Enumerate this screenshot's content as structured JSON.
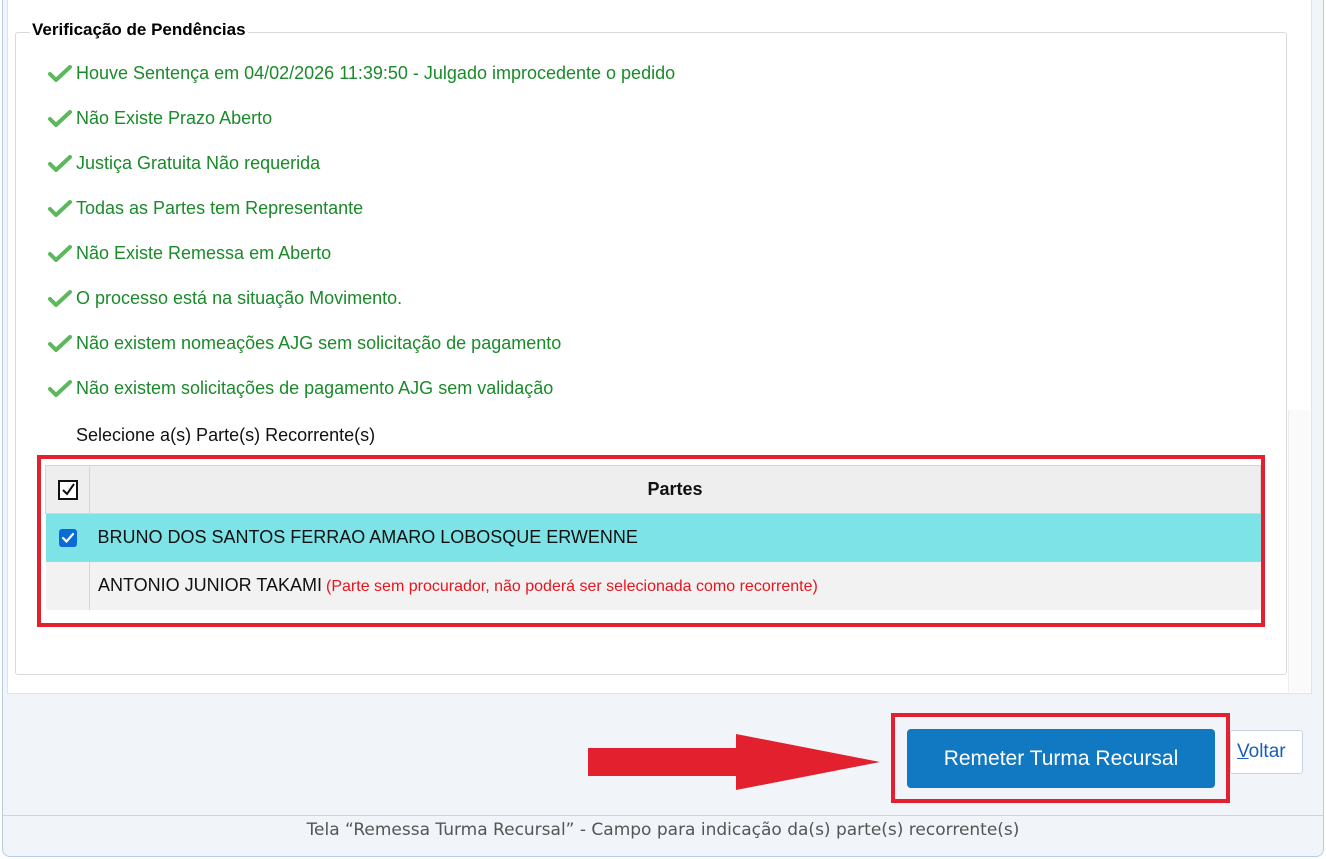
{
  "section": {
    "legend": "Verificação de Pendências",
    "checks": [
      "Houve Sentença em 04/02/2026 11:39:50 - Julgado improcedente o pedido",
      "Não Existe Prazo Aberto",
      "Justiça Gratuita Não requerida",
      "Todas as Partes tem Representante",
      "Não Existe Remessa em Aberto",
      "O processo está na situação Movimento.",
      "Não existem nomeações AJG sem solicitação de pagamento",
      "Não existem solicitações de pagamento AJG sem validação"
    ],
    "check_icon": "check-icon",
    "check_color": "#1a8a2a"
  },
  "selection": {
    "label": "Selecione a(s) Parte(s) Recorrente(s)",
    "header": "Partes",
    "header_checked": true,
    "rows": [
      {
        "name": "BRUNO DOS SANTOS FERRAO AMARO LOBOSQUE ERWENNE",
        "checked": true,
        "note": ""
      },
      {
        "name": "ANTONIO JUNIOR TAKAMI",
        "checked": false,
        "note": "(Parte sem procurador, não poderá ser selecionada como recorrente)"
      }
    ],
    "selected_row_color": "#7de3e6",
    "warning_color": "#e8141e"
  },
  "actions": {
    "primary_label": "Remeter Turma Recursal",
    "back_label_first": "V",
    "back_label_rest": "oltar",
    "primary_color": "#1178c2"
  },
  "annotation": {
    "highlight_color": "#e3202d",
    "arrow_color": "#e3202d"
  },
  "caption": "Tela “Remessa Turma Recursal” - Campo para indicação da(s) parte(s) recorrente(s)"
}
